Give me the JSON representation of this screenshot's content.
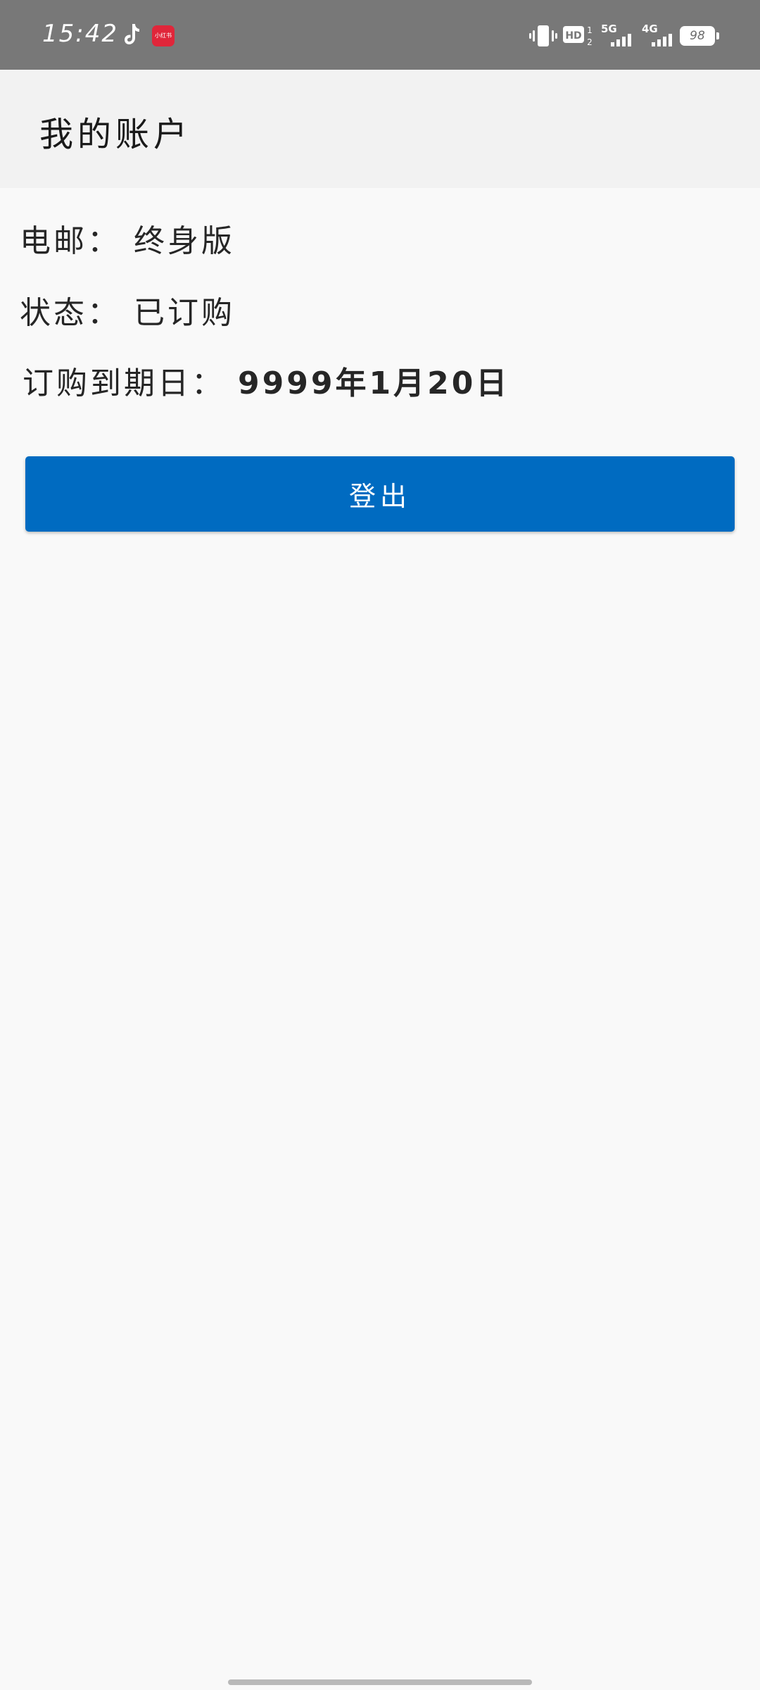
{
  "status_bar": {
    "time": "15:42",
    "app_badge_text": "小红书",
    "network_5g": "5G",
    "network_4g": "4G",
    "hd_label": "HD",
    "battery_level": "98",
    "icons": [
      "tiktok-icon",
      "app-badge",
      "vibrate-icon",
      "hd-icon",
      "signal-5g-icon",
      "signal-4g-icon",
      "battery-icon"
    ]
  },
  "app_bar": {
    "title": "我的账户"
  },
  "account": {
    "email_label": "电邮：",
    "email_value": "终身版",
    "status_label": "状态：",
    "status_value": "已订购",
    "expiry_label": "订购到期日：",
    "expiry_value": "9999年1月20日"
  },
  "actions": {
    "logout_label": "登出"
  },
  "colors": {
    "status_bar_bg": "#787878",
    "app_bar_bg": "#f2f2f2",
    "page_bg": "#f9f9f9",
    "button_bg": "#006bc1",
    "button_text": "#ffffff"
  }
}
